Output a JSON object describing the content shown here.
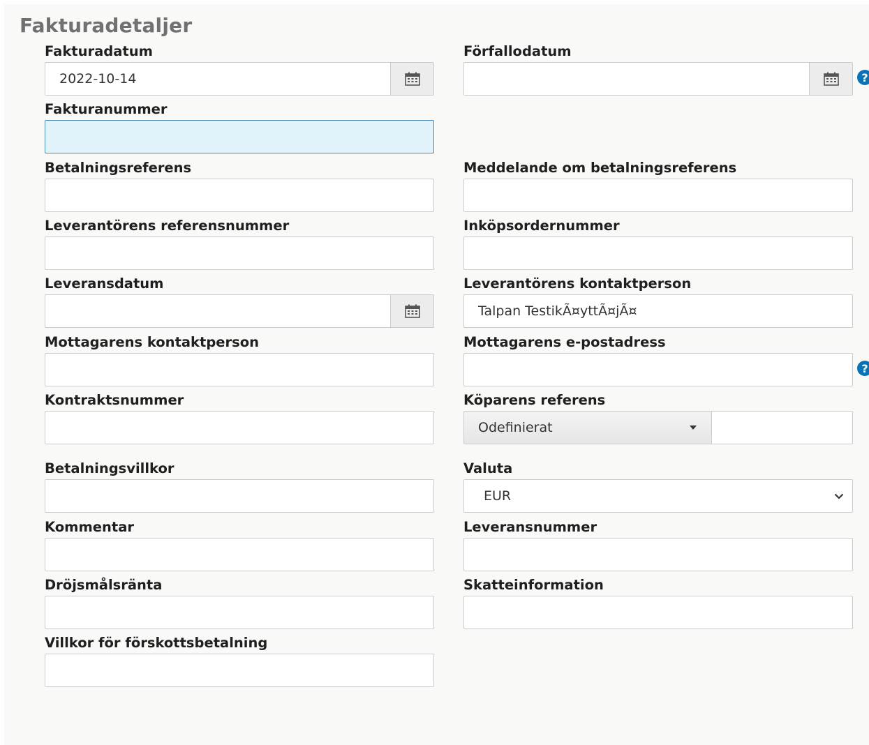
{
  "section": {
    "title": "Fakturadetaljer"
  },
  "fields": {
    "invoice_date": {
      "label": "Fakturadatum",
      "value": "2022-10-14"
    },
    "due_date": {
      "label": "Förfallodatum",
      "value": ""
    },
    "invoice_number": {
      "label": "Fakturanummer",
      "value": ""
    },
    "payment_reference": {
      "label": "Betalningsreferens",
      "value": ""
    },
    "payment_reference_message": {
      "label": "Meddelande om betalningsreferens",
      "value": ""
    },
    "supplier_reference_number": {
      "label": "Leverantörens referensnummer",
      "value": ""
    },
    "purchase_order_number": {
      "label": "Inköpsordernummer",
      "value": ""
    },
    "delivery_date": {
      "label": "Leveransdatum",
      "value": ""
    },
    "supplier_contact": {
      "label": "Leverantörens kontaktperson",
      "value": "Talpan TestikÃ¤yttÃ¤jÃ¤"
    },
    "recipient_contact": {
      "label": "Mottagarens kontaktperson",
      "value": ""
    },
    "recipient_email": {
      "label": "Mottagarens e-postadress",
      "value": ""
    },
    "contract_number": {
      "label": "Kontraktsnummer",
      "value": ""
    },
    "buyer_reference": {
      "label": "Köparens referens",
      "type_value": "Odefinierat",
      "value": ""
    },
    "payment_terms": {
      "label": "Betalningsvillkor",
      "value": ""
    },
    "currency": {
      "label": "Valuta",
      "value": "EUR"
    },
    "comment": {
      "label": "Kommentar",
      "value": ""
    },
    "delivery_number": {
      "label": "Leveransnummer",
      "value": ""
    },
    "late_interest": {
      "label": "Dröjsmålsränta",
      "value": ""
    },
    "tax_information": {
      "label": "Skatteinformation",
      "value": ""
    },
    "prepayment_terms": {
      "label": "Villkor för förskottsbetalning",
      "value": ""
    }
  },
  "icons": {
    "calendar": "calendar-icon",
    "help": "question-circle-icon",
    "caret": "caret-down-icon",
    "chevron": "chevron-down-icon"
  },
  "colors": {
    "focus_background": "#e2f2fb",
    "focus_border": "#4a8ab2",
    "help_icon": "#0b72b5",
    "section_title": "#707070"
  }
}
